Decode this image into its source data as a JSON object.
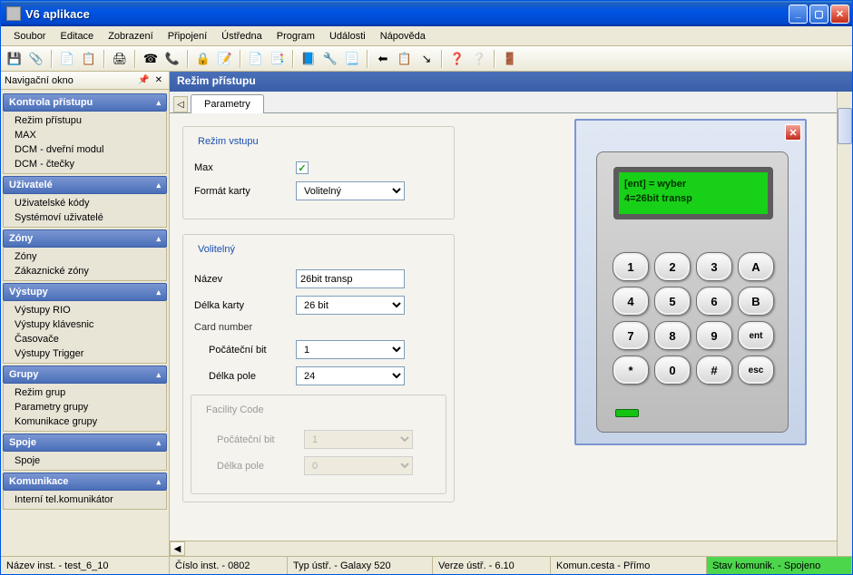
{
  "window": {
    "title": "V6 aplikace"
  },
  "menu": {
    "items": [
      "Soubor",
      "Editace",
      "Zobrazení",
      "Připojení",
      "Ústředna",
      "Program",
      "Události",
      "Nápověda"
    ]
  },
  "toolbar": {
    "icons": [
      "save-icon",
      "attach-icon",
      "copy-icon",
      "paste-icon",
      "print-icon",
      "phone-icon",
      "phone2-icon",
      "lock-icon",
      "note-icon",
      "doc1-icon",
      "doc2-icon",
      "book-icon",
      "tool-icon",
      "page-icon",
      "back-icon",
      "list-icon",
      "export-icon",
      "help-icon",
      "whatsthis-icon",
      "exit-icon"
    ],
    "glyphs": [
      "💾",
      "📎",
      "📄",
      "📋",
      "🖨",
      "☎",
      "📞",
      "🔒",
      "📝",
      "📄",
      "📑",
      "📘",
      "🔧",
      "📃",
      "⬅",
      "📋",
      "↘",
      "❓",
      "❔",
      "🚪"
    ]
  },
  "nav": {
    "title": "Navigační okno",
    "groups": [
      {
        "title": "Kontrola přístupu",
        "items": [
          "Režim přístupu",
          "MAX",
          "DCM - dveřní modul",
          "DCM - čtečky"
        ]
      },
      {
        "title": "Uživatelé",
        "items": [
          "Uživatelské kódy",
          "Systémoví uživatelé"
        ]
      },
      {
        "title": "Zóny",
        "items": [
          "Zóny",
          "Zákaznické zóny"
        ]
      },
      {
        "title": "Výstupy",
        "items": [
          "Výstupy RIO",
          "Výstupy klávesnic",
          "Časovače",
          "Výstupy Trigger"
        ]
      },
      {
        "title": "Grupy",
        "items": [
          "Režim grup",
          "Parametry grupy",
          "Komunikace grupy"
        ]
      },
      {
        "title": "Spoje",
        "items": [
          "Spoje"
        ]
      },
      {
        "title": "Komunikace",
        "items": [
          "Interní tel.komunikátor"
        ]
      }
    ]
  },
  "main": {
    "header": "Režim přístupu",
    "tab": "Parametry",
    "section1": {
      "legend": "Režim vstupu",
      "max_label": "Max",
      "max_checked": true,
      "format_label": "Formát karty",
      "format_value": "Volitelný"
    },
    "section2": {
      "legend": "Volitelný",
      "name_label": "Název",
      "name_value": "26bit transp",
      "len_label": "Délka karty",
      "len_value": "26 bit",
      "cardnum_title": "Card number",
      "start_label": "Počáteční bit",
      "start_value": "1",
      "flen_label": "Délka pole",
      "flen_value": "24",
      "fac_legend": "Facility Code",
      "fac_start_label": "Počáteční bit",
      "fac_start_value": "1",
      "fac_len_label": "Délka pole",
      "fac_len_value": "0"
    }
  },
  "keypad": {
    "lcd_line1": "[ent] = wyber",
    "lcd_line2": "4=26bit transp",
    "keys": [
      "1",
      "2",
      "3",
      "A",
      "4",
      "5",
      "6",
      "B",
      "7",
      "8",
      "9",
      "ent",
      "*",
      "0",
      "#",
      "esc"
    ]
  },
  "status": {
    "cell1": "Název inst. - test_6_10",
    "cell2": "Číslo inst. - 0802",
    "cell3": "Typ ústř. - Galaxy 520",
    "cell4": "Verze ústř. - 6.10",
    "cell5": "Komun.cesta - Přímo",
    "cell6": "Stav komunik. - Spojeno"
  }
}
